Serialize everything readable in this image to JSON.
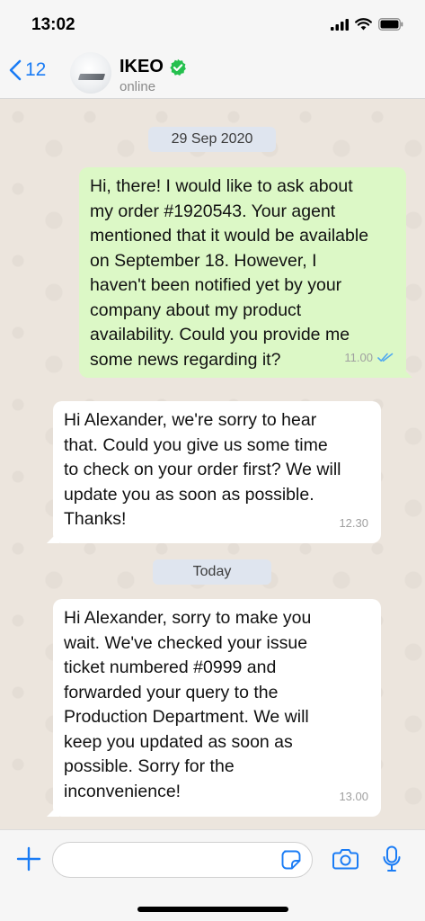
{
  "status_bar": {
    "time": "13:02"
  },
  "header": {
    "back_count": "12",
    "contact_name": "IKEO",
    "contact_status": "online"
  },
  "chat": {
    "date_separators": [
      "29 Sep 2020",
      "Today"
    ],
    "messages": [
      {
        "direction": "outgoing",
        "text": "Hi, there! I would like to ask about\nmy order #1920543. Your agent\nmentioned that it would be available\non September 18. However, I\nhaven't been notified yet by your\ncompany about my product\navailability. Could you provide me\nsome news regarding it?",
        "time": "11.00",
        "read": true
      },
      {
        "direction": "incoming",
        "text": "Hi Alexander, we're sorry to hear\nthat. Could you give us some time\nto check on your order first? We will\nupdate you as soon as possible.\nThanks!",
        "time": "12.30"
      },
      {
        "direction": "incoming",
        "text": "Hi Alexander, sorry to make you\nwait. We've checked your issue\nticket numbered #0999 and\nforwarded your query to the\nProduction Department. We will\nkeep you updated as soon as\npossible. Sorry for the\ninconvenience!",
        "time": "13.00"
      }
    ]
  },
  "composer": {
    "value": "",
    "placeholder": ""
  },
  "colors": {
    "accent": "#1a7cf5",
    "outgoing_bubble": "#dcf8c6",
    "incoming_bubble": "#ffffff",
    "verified_badge": "#25c04e",
    "read_ticks": "#4fa8f0"
  },
  "icons": [
    "back-chevron-icon",
    "verified-badge-icon",
    "signal-icon",
    "wifi-icon",
    "battery-icon",
    "plus-icon",
    "sticker-icon",
    "camera-icon",
    "microphone-icon",
    "double-check-icon"
  ]
}
